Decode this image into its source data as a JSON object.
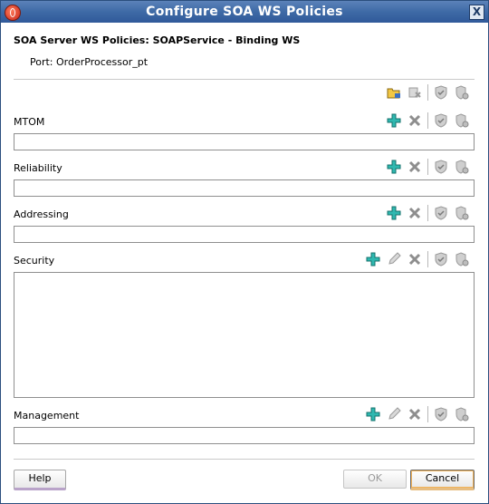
{
  "window": {
    "title": "Configure SOA WS Policies",
    "close_label": "X"
  },
  "header": {
    "title": "SOA Server WS Policies: SOAPService - Binding WS",
    "port": "Port: OrderProcessor_pt"
  },
  "sections": {
    "mtom": {
      "label": "MTOM"
    },
    "reliability": {
      "label": "Reliability"
    },
    "addressing": {
      "label": "Addressing"
    },
    "security": {
      "label": "Security"
    },
    "management": {
      "label": "Management"
    }
  },
  "buttons": {
    "help": "Help",
    "ok": "OK",
    "cancel": "Cancel"
  },
  "icons": {
    "add": "add-icon",
    "edit": "edit-pencil-icon",
    "delete": "delete-x-icon",
    "validate": "validate-shield-icon",
    "configure": "configure-shield-icon",
    "folder": "open-folder-icon",
    "attach": "attach-icon"
  },
  "colors": {
    "titlebar": "#3e6aa6",
    "add_icon": "#2fb8b0",
    "cancel_focus": "#f0b25a",
    "help_accent": "#b9a3c9"
  }
}
